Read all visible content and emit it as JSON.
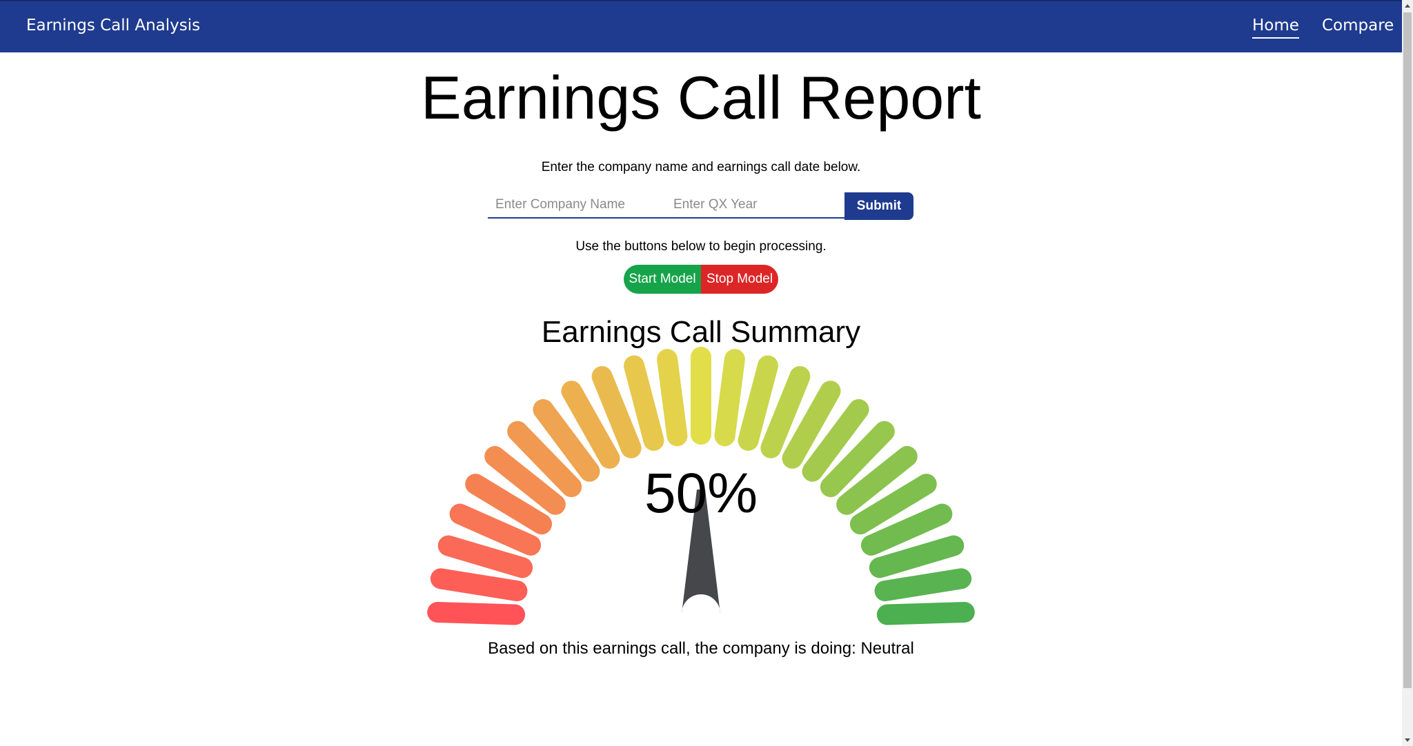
{
  "navbar": {
    "brand": "Earnings Call Analysis",
    "links": [
      "Home",
      "Compare"
    ],
    "background": "#1f3b8f"
  },
  "main": {
    "title": "Earnings Call Report",
    "instruction_form": "Enter the company name and earnings call date below.",
    "company_placeholder": "Enter Company Name",
    "company_value": "",
    "date_placeholder": "Enter QX Year",
    "date_value": "",
    "submit_label": "Submit",
    "instruction_buttons": "Use the buttons below to begin processing.",
    "start_label": "Start Model",
    "stop_label": "Stop Model",
    "start_color": "#16a34a",
    "stop_color": "#dc2626"
  },
  "summary": {
    "title": "Earnings Call Summary",
    "gauge_text": "50%",
    "gauge_level": 0.5,
    "result_text": "Based on this earnings call, the company is doing: Neutral",
    "gauge_low_color": "#ff5358",
    "gauge_mid_color": "#e2de4a",
    "gauge_high_color": "#4caf50",
    "needle_color": "#45474b"
  }
}
